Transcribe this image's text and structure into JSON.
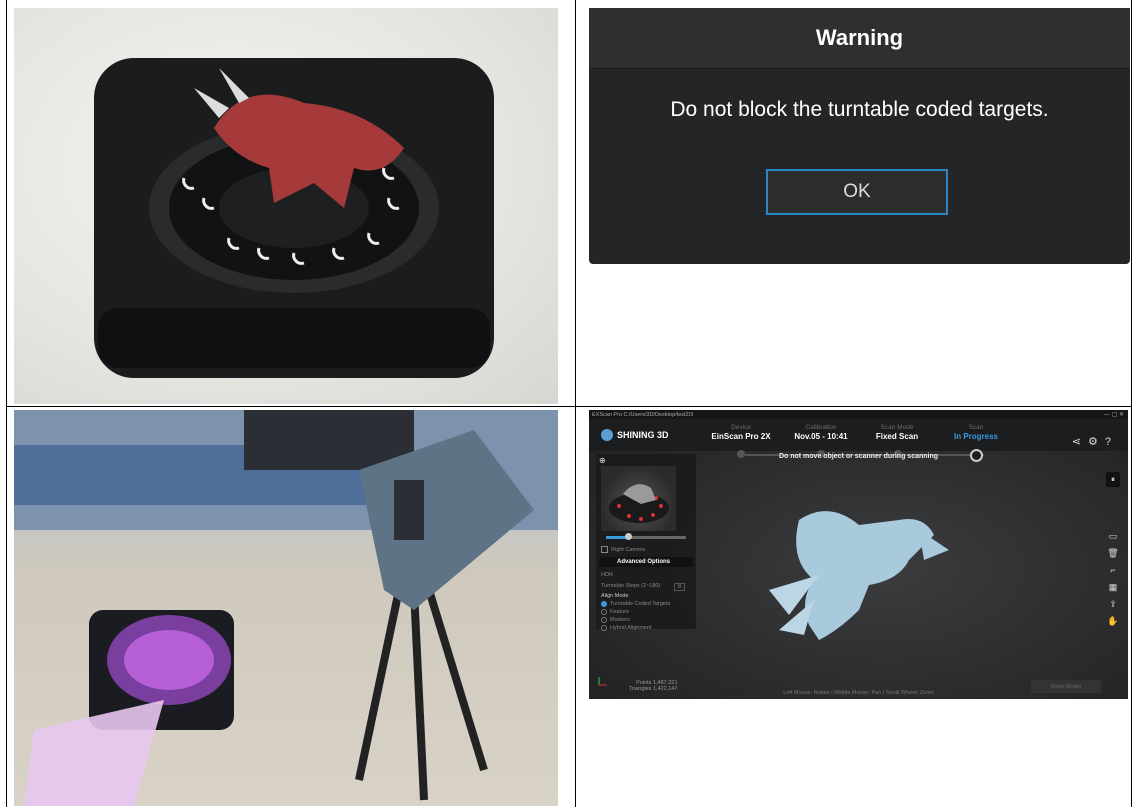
{
  "dialog": {
    "title": "Warning",
    "message": "Do not block the turntable coded targets.",
    "ok_label": "OK"
  },
  "app": {
    "titlebar_text": "EXScan Pro  C:/Users/3D/Desktop/test2/3",
    "window_controls": "—  ▢  ✕",
    "logo": "SHINING 3D",
    "steps": [
      {
        "label": "Device",
        "value": "EinScan Pro 2X"
      },
      {
        "label": "Calibration",
        "value": "Nov.05 - 10:41"
      },
      {
        "label": "Scan Mode",
        "value": "Fixed Scan"
      },
      {
        "label": "Scan",
        "value": "In Progress"
      }
    ],
    "notice": "Do not move object or scanner during scanning",
    "right_camera": "Right Camera",
    "advanced_options": "Advanced Options",
    "hdr": "HDR",
    "turntable_steps_label": "Turntable Steps (2~180)",
    "turntable_steps_value": "8",
    "align_mode": "Align Mode",
    "align_options": [
      "Turntable Coded Targets",
      "Feature",
      "Markers",
      "Hybrid Alignment"
    ],
    "stats_points": "Points 1,487,321",
    "stats_triangles": "Triangles 1,422,147",
    "footer": "Left Mouse: Rotate | Middle Mouse: Pan | Scroll Wheel: Zoom",
    "mesh_button": "Mesh Model"
  },
  "colors": {
    "accent": "#3a9be0",
    "dialog_bg": "#232527",
    "mesh": "#a9c9dc"
  }
}
